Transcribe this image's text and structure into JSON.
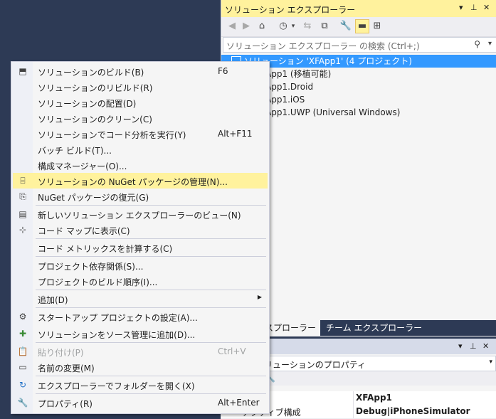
{
  "solution_explorer": {
    "title": "ソリューション エクスプローラー",
    "pin": "📌",
    "close": "✕",
    "dropdown": "▾",
    "search_placeholder": "ソリューション エクスプローラー の検索 (Ctrl+;)",
    "tree": [
      {
        "label": "ソリューション 'XFApp1' (4 プロジェクト)",
        "selected": true
      },
      {
        "label": "App1 (移植可能)"
      },
      {
        "label": "App1.Droid"
      },
      {
        "label": "App1.iOS"
      },
      {
        "label": "App1.UWP (Universal Windows)"
      }
    ],
    "tabs": [
      {
        "label": "エクスプローラー",
        "active": true
      },
      {
        "label": "チーム エクスプローラー"
      }
    ]
  },
  "properties": {
    "combo_value": "リューションのプロパティ",
    "rows": [
      {
        "key": "",
        "value": "XFApp1"
      },
      {
        "key": "アクティブ構成",
        "value": "Debug|iPhoneSimulator"
      }
    ]
  },
  "menu": {
    "items": [
      {
        "label": "ソリューションのビルド(B)",
        "shortcut": "F6",
        "icon": "build-icon"
      },
      {
        "label": "ソリューションのリビルド(R)",
        "shortcut": ""
      },
      {
        "label": "ソリューションの配置(D)",
        "shortcut": ""
      },
      {
        "label": "ソリューションのクリーン(C)",
        "shortcut": ""
      },
      {
        "label": "ソリューションでコード分析を実行(Y)",
        "shortcut": "Alt+F11"
      },
      {
        "label": "バッチ ビルド(T)...",
        "shortcut": ""
      },
      {
        "label": "構成マネージャー(O)...",
        "shortcut": ""
      },
      {
        "label": "ソリューションの NuGet パッケージの管理(N)...",
        "shortcut": "",
        "icon": "nuget-icon",
        "highlighted": true
      },
      {
        "label": "NuGet パッケージの復元(G)",
        "shortcut": "",
        "icon": "restore-icon"
      },
      {
        "label": "新しいソリューション エクスプローラーのビュー(N)",
        "shortcut": "",
        "icon": "new-view-icon"
      },
      {
        "label": "コード マップに表示(C)",
        "shortcut": "",
        "icon": "codemap-icon"
      },
      {
        "label": "コード メトリックスを計算する(C)",
        "shortcut": ""
      },
      {
        "label": "プロジェクト依存関係(S)...",
        "shortcut": ""
      },
      {
        "label": "プロジェクトのビルド順序(I)...",
        "shortcut": ""
      },
      {
        "label": "追加(D)",
        "shortcut": "",
        "submenu": true
      },
      {
        "label": "スタートアップ プロジェクトの設定(A)...",
        "shortcut": "",
        "icon": "gear-icon"
      },
      {
        "label": "ソリューションをソース管理に追加(D)...",
        "shortcut": "",
        "icon": "source-control-icon"
      },
      {
        "label": "貼り付け(P)",
        "shortcut": "Ctrl+V",
        "icon": "paste-icon",
        "disabled": true
      },
      {
        "label": "名前の変更(M)",
        "shortcut": "",
        "icon": "rename-icon"
      },
      {
        "label": "エクスプローラーでフォルダーを開く(X)",
        "shortcut": "",
        "icon": "open-folder-icon"
      },
      {
        "label": "プロパティ(R)",
        "shortcut": "Alt+Enter",
        "icon": "wrench-icon"
      }
    ]
  }
}
